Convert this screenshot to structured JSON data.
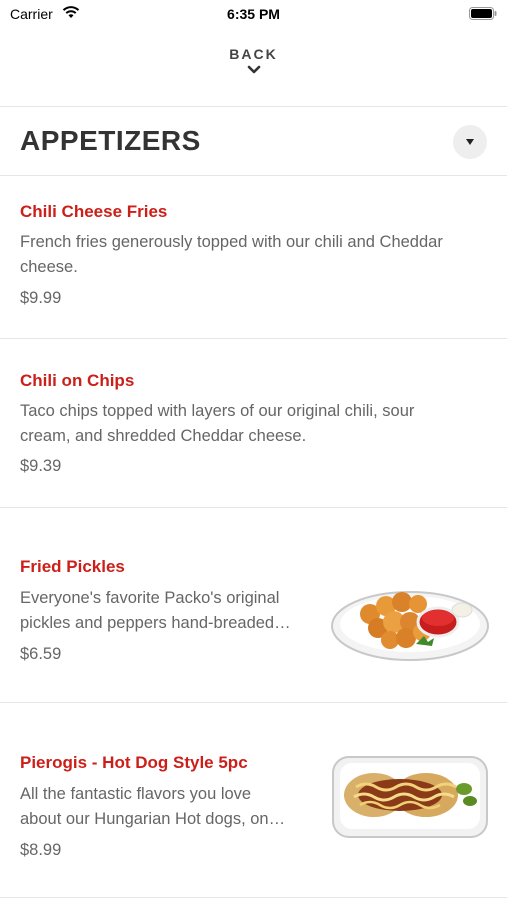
{
  "status_bar": {
    "carrier": "Carrier",
    "time": "6:35 PM"
  },
  "nav": {
    "back_label": "BACK"
  },
  "section": {
    "title": "APPETIZERS"
  },
  "items": [
    {
      "name": "Chili Cheese Fries",
      "description_line1": "French fries generously topped with our chili and Cheddar",
      "description_line2": "cheese.",
      "price": "$9.99"
    },
    {
      "name": "Chili on Chips",
      "description_line1": "Taco chips topped with layers of our original chili, sour",
      "description_line2": "cream, and shredded Cheddar cheese.",
      "price": "$9.39"
    },
    {
      "name": "Fried Pickles",
      "description_line1": "Everyone's favorite Packo's original",
      "description_line2": "pickles and peppers hand-breaded…",
      "price": "$6.59"
    },
    {
      "name": "Pierogis - Hot Dog Style 5pc",
      "description_line1": "All the fantastic flavors you love",
      "description_line2": "about our Hungarian Hot dogs, on…",
      "price": "$8.99"
    }
  ],
  "colors": {
    "accent": "#cc1f1a",
    "text": "#333333",
    "muted": "#666666",
    "divider": "#e6e6e6"
  }
}
